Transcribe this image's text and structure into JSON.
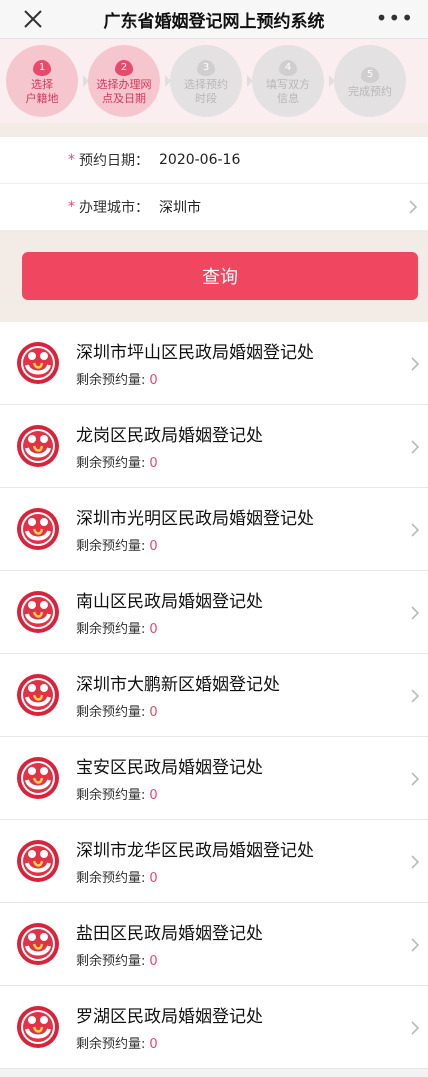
{
  "header": {
    "title": "广东省婚姻登记网上预约系统",
    "more_label": "•••",
    "close_icon": "close-icon"
  },
  "steps": [
    {
      "num": "1",
      "label_l1": "选择",
      "label_l2": "户籍地",
      "state": "active"
    },
    {
      "num": "2",
      "label_l1": "选择办理网",
      "label_l2": "点及日期",
      "state": "active"
    },
    {
      "num": "3",
      "label_l1": "选择预约",
      "label_l2": "时段",
      "state": "inactive"
    },
    {
      "num": "4",
      "label_l1": "填写双方",
      "label_l2": "信息",
      "state": "inactive"
    },
    {
      "num": "5",
      "label_l1": "完成预约",
      "label_l2": "",
      "state": "inactive"
    }
  ],
  "form": {
    "date_label": "预约日期：",
    "date_value": "2020-06-16",
    "city_label": "办理城市：",
    "city_value": "深圳市",
    "required_mark": "*"
  },
  "query_button": "查询",
  "remain_label": "剩余预约量:",
  "offices": [
    {
      "name": "深圳市坪山区民政局婚姻登记处",
      "remain": "0"
    },
    {
      "name": "龙岗区民政局婚姻登记处",
      "remain": "0"
    },
    {
      "name": "深圳市光明区民政局婚姻登记处",
      "remain": "0"
    },
    {
      "name": "南山区民政局婚姻登记处",
      "remain": "0"
    },
    {
      "name": "深圳市大鹏新区婚姻登记处",
      "remain": "0"
    },
    {
      "name": "宝安区民政局婚姻登记处",
      "remain": "0"
    },
    {
      "name": "深圳市龙华区民政局婚姻登记处",
      "remain": "0"
    },
    {
      "name": "盐田区民政局婚姻登记处",
      "remain": "0"
    },
    {
      "name": "罗湖区民政局婚姻登记处",
      "remain": "0"
    }
  ],
  "colors": {
    "accent": "#f0465f",
    "step_active_bg": "#f6c6cf",
    "step_inactive_bg": "#e3e1e2"
  }
}
